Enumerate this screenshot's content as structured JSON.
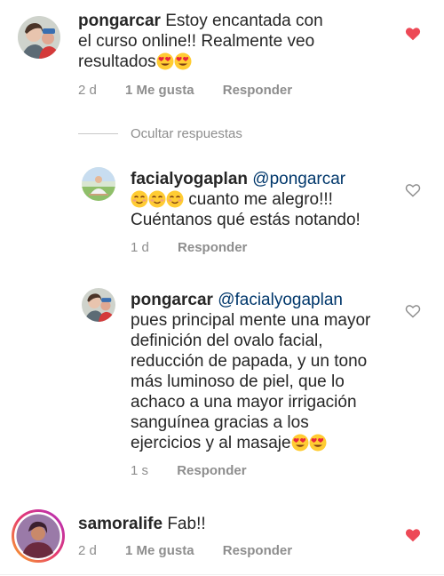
{
  "comments": [
    {
      "username": "pongarcar",
      "text_lines": [
        "Estoy encantada con",
        "el curso online!! Realmente veo",
        "resultados"
      ],
      "emojis": [
        "heart-eyes-emoji",
        "heart-eyes-emoji"
      ],
      "time": "2 d",
      "likes": "1 Me gusta",
      "reply": "Responder",
      "liked": true
    },
    {
      "username": "samoralife",
      "text_lines": [
        "Fab!!"
      ],
      "time": "2 d",
      "likes": "1 Me gusta",
      "reply": "Responder",
      "liked": true
    }
  ],
  "replies_toggle": "Ocultar respuestas",
  "replies": [
    {
      "username": "facialyogaplan",
      "mention": "@pongarcar",
      "emojis_lead": [
        "smiling-blush-emoji",
        "smiling-blush-emoji",
        "smiling-blush-emoji"
      ],
      "text_lines": [
        "cuanto me alegro!!!",
        "Cuéntanos qué estás notando!"
      ],
      "time": "1 d",
      "reply": "Responder",
      "liked": false
    },
    {
      "username": "pongarcar",
      "mention": "@facialyogaplan",
      "text_lines": [
        "pues principal mente una mayor",
        "definición del ovalo facial,",
        "reducción de papada, y un tono",
        "más luminoso de piel, que lo",
        "achaco a una mayor irrigación",
        "sanguínea gracias a los",
        "ejercicios y al masaje"
      ],
      "emojis": [
        "heart-eyes-emoji",
        "heart-eyes-emoji"
      ],
      "time": "1 s",
      "reply": "Responder",
      "liked": false
    }
  ],
  "colors": {
    "liked_heart": "#ed4956",
    "meta_gray": "#8e8e8e",
    "mention_blue": "#00376b",
    "text": "#262626"
  }
}
